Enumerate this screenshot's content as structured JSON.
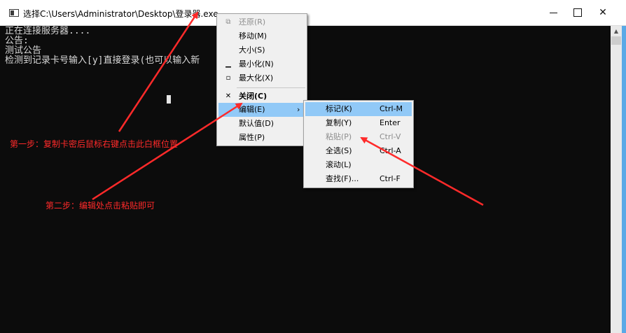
{
  "window": {
    "title": "选择C:\\Users\\Administrator\\Desktop\\登录器.exe",
    "icon": "console-app-icon"
  },
  "console": {
    "lines": [
      "正在连接服务器....",
      "公告:",
      "测试公告",
      "检测到记录卡号输入[y]直接登录(也可以输入新"
    ]
  },
  "system_menu": {
    "items": [
      {
        "label": "还原(R)",
        "icon": "restore-icon",
        "disabled": true
      },
      {
        "label": "移动(M)"
      },
      {
        "label": "大小(S)"
      },
      {
        "label": "最小化(N)",
        "icon": "minimize-icon"
      },
      {
        "label": "最大化(X)",
        "icon": "maximize-icon"
      },
      {
        "label": "关闭(C)",
        "icon": "close-icon",
        "bold": true
      },
      {
        "label": "编辑(E)",
        "submenu": true,
        "highlighted": true
      },
      {
        "label": "默认值(D)"
      },
      {
        "label": "属性(P)"
      }
    ]
  },
  "edit_submenu": {
    "items": [
      {
        "label": "标记(K)",
        "shortcut": "Ctrl-M",
        "highlighted": true
      },
      {
        "label": "复制(Y)",
        "shortcut": "Enter"
      },
      {
        "label": "粘贴(P)",
        "shortcut": "Ctrl-V",
        "disabled": true
      },
      {
        "label": "全选(S)",
        "shortcut": "Ctrl-A"
      },
      {
        "label": "滚动(L)",
        "shortcut": ""
      },
      {
        "label": "查找(F)...",
        "shortcut": "Ctrl-F"
      }
    ]
  },
  "annotations": {
    "step1": "第一步：复制卡密后鼠标右键点击此白框位置",
    "step2": "第二步：编辑处点击粘贴即可"
  },
  "colors": {
    "console_bg": "#0c0c0c",
    "console_text": "#d9d9d9",
    "menu_bg": "#f0f0f0",
    "menu_highlight": "#91c9f7",
    "annotation": "#ff2a2a"
  }
}
